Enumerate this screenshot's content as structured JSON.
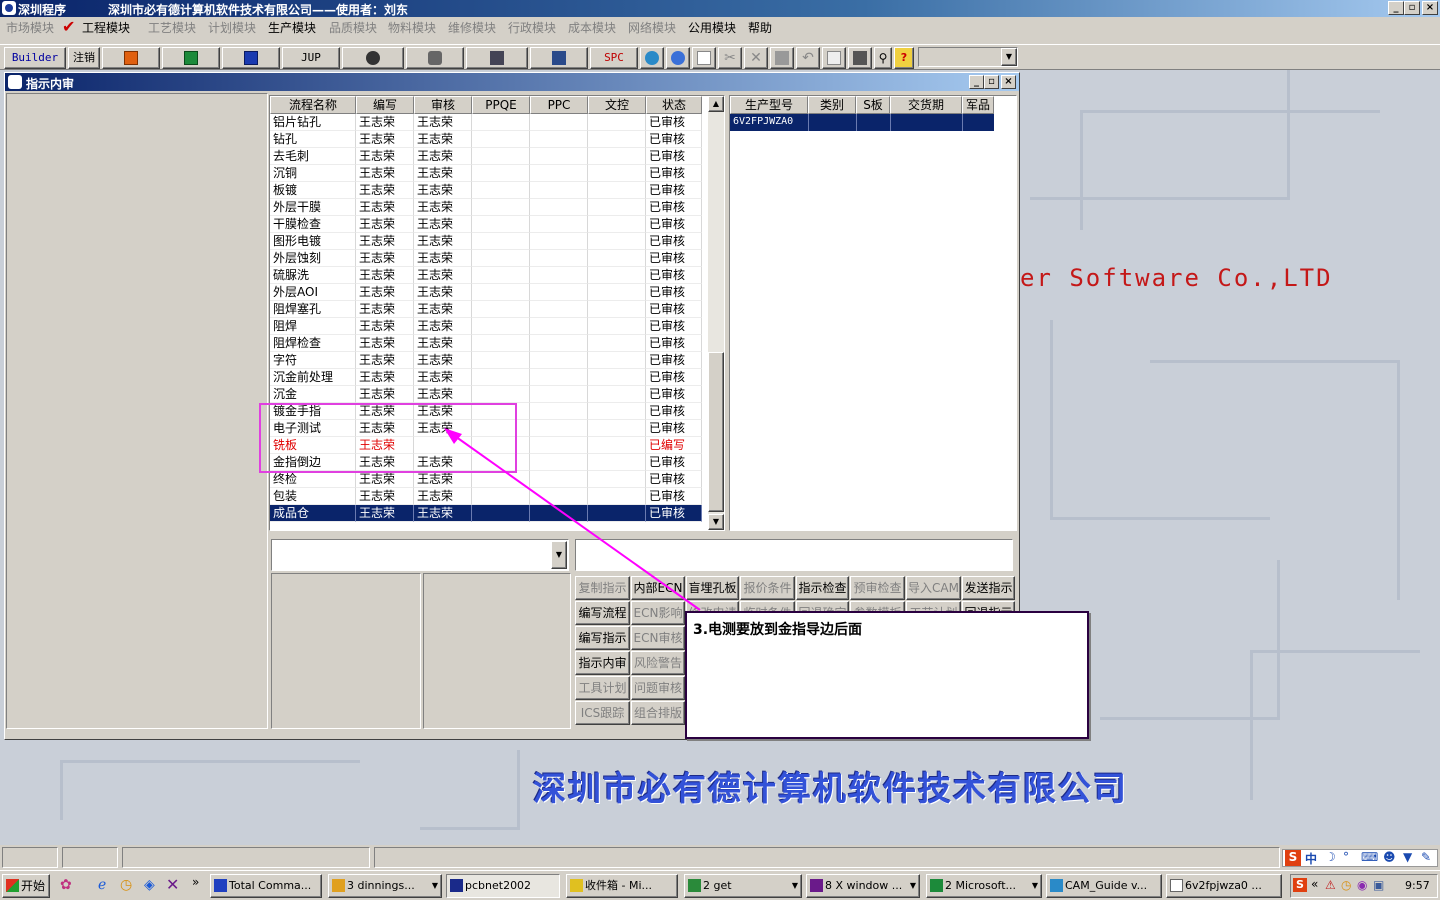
{
  "window": {
    "app_title": "深圳程序",
    "company_title": "深圳市必有德计算机软件技术有限公司——使用者：刘东",
    "controls": [
      "_",
      "▫",
      "×"
    ]
  },
  "menu": [
    "市场模块",
    "工程模块",
    "工艺模块",
    "计划模块",
    "生产模块",
    "品质模块",
    "物料模块",
    "维修模块",
    "行政模块",
    "成本模块",
    "网络模块",
    "公用模块",
    "帮助"
  ],
  "menu_active": [
    "工程模块",
    "生产模块",
    "公用模块",
    "帮助"
  ],
  "toolbar": {
    "builder": "Builder",
    "logout": "注销",
    "jup": "JUP",
    "spc": "SPC"
  },
  "background": {
    "software_text": "er Software Co.,LTD",
    "banner": "深圳市必有德计算机软件技术有限公司"
  },
  "child_window": {
    "title": "指示内审",
    "process_table": {
      "columns": [
        "流程名称",
        "编写",
        "审核",
        "PPQE",
        "PPC",
        "文控",
        "状态"
      ],
      "rows": [
        [
          "铝片钻孔",
          "王志荣",
          "王志荣",
          "",
          "",
          "",
          "已审核"
        ],
        [
          "钻孔",
          "王志荣",
          "王志荣",
          "",
          "",
          "",
          "已审核"
        ],
        [
          "去毛刺",
          "王志荣",
          "王志荣",
          "",
          "",
          "",
          "已审核"
        ],
        [
          "沉铜",
          "王志荣",
          "王志荣",
          "",
          "",
          "",
          "已审核"
        ],
        [
          "板镀",
          "王志荣",
          "王志荣",
          "",
          "",
          "",
          "已审核"
        ],
        [
          "外层干膜",
          "王志荣",
          "王志荣",
          "",
          "",
          "",
          "已审核"
        ],
        [
          "干膜检查",
          "王志荣",
          "王志荣",
          "",
          "",
          "",
          "已审核"
        ],
        [
          "图形电镀",
          "王志荣",
          "王志荣",
          "",
          "",
          "",
          "已审核"
        ],
        [
          "外层蚀刻",
          "王志荣",
          "王志荣",
          "",
          "",
          "",
          "已审核"
        ],
        [
          "硫脲洗",
          "王志荣",
          "王志荣",
          "",
          "",
          "",
          "已审核"
        ],
        [
          "外层AOI",
          "王志荣",
          "王志荣",
          "",
          "",
          "",
          "已审核"
        ],
        [
          "阻焊塞孔",
          "王志荣",
          "王志荣",
          "",
          "",
          "",
          "已审核"
        ],
        [
          "阻焊",
          "王志荣",
          "王志荣",
          "",
          "",
          "",
          "已审核"
        ],
        [
          "阻焊检查",
          "王志荣",
          "王志荣",
          "",
          "",
          "",
          "已审核"
        ],
        [
          "字符",
          "王志荣",
          "王志荣",
          "",
          "",
          "",
          "已审核"
        ],
        [
          "沉金前处理",
          "王志荣",
          "王志荣",
          "",
          "",
          "",
          "已审核"
        ],
        [
          "沉金",
          "王志荣",
          "王志荣",
          "",
          "",
          "",
          "已审核"
        ],
        [
          "镀金手指",
          "王志荣",
          "王志荣",
          "",
          "",
          "",
          "已审核"
        ],
        [
          "电子测试",
          "王志荣",
          "王志荣",
          "",
          "",
          "",
          "已审核"
        ],
        [
          "铣板",
          "王志荣",
          "",
          "",
          "",
          "",
          "已编写"
        ],
        [
          "金指倒边",
          "王志荣",
          "王志荣",
          "",
          "",
          "",
          "已审核"
        ],
        [
          "终检",
          "王志荣",
          "王志荣",
          "",
          "",
          "",
          "已审核"
        ],
        [
          "包装",
          "王志荣",
          "王志荣",
          "",
          "",
          "",
          "已审核"
        ],
        [
          "成品仓",
          "王志荣",
          "王志荣",
          "",
          "",
          "",
          "已审核"
        ]
      ],
      "highlight_red_row": "铣板",
      "selected_row": "成品仓"
    },
    "product_table": {
      "columns": [
        "生产型号",
        "类别",
        "S板",
        "交货期",
        "军品"
      ],
      "rows": [
        [
          "6V2FPJWZA0",
          "",
          "",
          "",
          ""
        ]
      ]
    },
    "buttons": [
      [
        "复制指示",
        "内部ECN",
        "盲埋孔板",
        "报价条件",
        "指示检查",
        "预审检查",
        "导入CAM",
        "发送指示"
      ],
      [
        "编写流程",
        "ECN影响",
        "修改申请",
        "临时条件",
        "回退确定",
        "参数模板",
        "工艺计划",
        "回退指示"
      ],
      [
        "编写指示",
        "ECN审核"
      ],
      [
        "指示内审",
        "风险警告"
      ],
      [
        "工具计划",
        "问题审核"
      ],
      [
        "ICS跟踪",
        "组合排版"
      ]
    ],
    "buttons_enabled": [
      "内部ECN",
      "盲埋孔板",
      "指示检查",
      "发送指示",
      "编写流程",
      "回退指示",
      "编写指示",
      "指示内审"
    ]
  },
  "annotation": {
    "note": "3.电测要放到金指导边后面"
  },
  "taskbar": {
    "start": "开始",
    "tasks": [
      "Total Comma...",
      "3 dinnings...",
      "pcbnet2002",
      "收件箱 - Mi...",
      "2 get",
      "8 X window ...",
      "2 Microsoft...",
      "CAM_Guide v...",
      "6v2fpjwza0 ..."
    ],
    "ime": "中",
    "clock": "9:57"
  },
  "colors": {
    "title": "#0a246a",
    "selection": "#0a246a",
    "annotation": "#ff00ff",
    "red": "#e00000",
    "banner": "#3352d8"
  }
}
